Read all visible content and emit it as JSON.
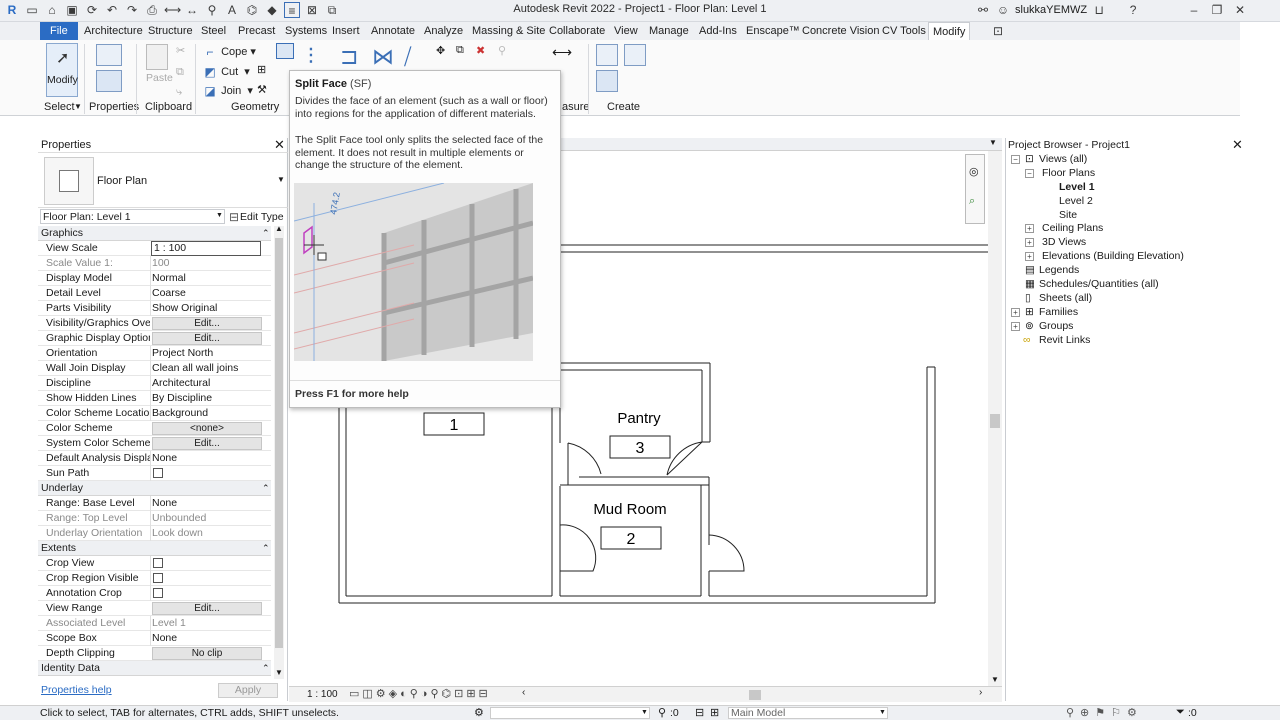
{
  "window": {
    "title": "Autodesk Revit 2022 - Project1 - Floor Plan: Level 1",
    "user": "slukkaYEMWZ"
  },
  "tabs": [
    "File",
    "Architecture",
    "Structure",
    "Steel",
    "Precast",
    "Systems",
    "Insert",
    "Annotate",
    "Analyze",
    "Massing & Site",
    "Collaborate",
    "View",
    "Manage",
    "Add-Ins",
    "Enscape™",
    "Concrete Vision",
    "CV Tools",
    "Modify"
  ],
  "ribbon": {
    "modify_label": "Modify",
    "cope": "Cope",
    "cut": "Cut",
    "join": "Join",
    "paste": "Paste",
    "panels": {
      "select": "Select",
      "properties": "Properties",
      "clipboard": "Clipboard",
      "geometry": "Geometry",
      "measure": "asure",
      "create": "Create"
    }
  },
  "tooltip": {
    "title": "Split Face",
    "shortcut": "(SF)",
    "desc1": "Divides the face of an element (such as a wall or floor) into regions for the application of different materials.",
    "desc2": "The Split Face tool only splits the selected face of the element. It does not result in multiple elements or change the structure of the element.",
    "dimension": "474.2",
    "footer": "Press F1 for more help"
  },
  "properties": {
    "title": "Properties",
    "type_name": "Floor Plan",
    "instance": "Floor Plan: Level 1",
    "edit_type": "Edit Type",
    "groups": {
      "graphics": "Graphics",
      "underlay": "Underlay",
      "extents": "Extents",
      "identity": "Identity Data"
    },
    "rows": {
      "view_scale": {
        "name": "View Scale",
        "value": "1 : 100"
      },
      "scale_value": {
        "name": "Scale Value    1:",
        "value": "100"
      },
      "display_model": {
        "name": "Display Model",
        "value": "Normal"
      },
      "detail_level": {
        "name": "Detail Level",
        "value": "Coarse"
      },
      "parts_visibility": {
        "name": "Parts Visibility",
        "value": "Show Original"
      },
      "vis_graphics": {
        "name": "Visibility/Graphics Over...",
        "value": "Edit..."
      },
      "graphic_display": {
        "name": "Graphic Display Options",
        "value": "Edit..."
      },
      "orientation": {
        "name": "Orientation",
        "value": "Project North"
      },
      "wall_join": {
        "name": "Wall Join Display",
        "value": "Clean all wall joins"
      },
      "discipline": {
        "name": "Discipline",
        "value": "Architectural"
      },
      "hidden_lines": {
        "name": "Show Hidden Lines",
        "value": "By Discipline"
      },
      "color_scheme_loc": {
        "name": "Color Scheme Location",
        "value": "Background"
      },
      "color_scheme": {
        "name": "Color Scheme",
        "value": "<none>"
      },
      "system_color": {
        "name": "System Color Schemes",
        "value": "Edit..."
      },
      "default_analysis": {
        "name": "Default Analysis Displa...",
        "value": "None"
      },
      "sun_path": {
        "name": "Sun Path",
        "value": ""
      },
      "range_base": {
        "name": "Range: Base Level",
        "value": "None"
      },
      "range_top": {
        "name": "Range: Top Level",
        "value": "Unbounded"
      },
      "underlay_orient": {
        "name": "Underlay Orientation",
        "value": "Look down"
      },
      "crop_view": {
        "name": "Crop View",
        "value": ""
      },
      "crop_region": {
        "name": "Crop Region Visible",
        "value": ""
      },
      "annotation_crop": {
        "name": "Annotation Crop",
        "value": ""
      },
      "view_range": {
        "name": "View Range",
        "value": "Edit..."
      },
      "assoc_level": {
        "name": "Associated Level",
        "value": "Level 1"
      },
      "scope_box": {
        "name": "Scope Box",
        "value": "None"
      },
      "depth_clipping": {
        "name": "Depth Clipping",
        "value": "No clip"
      }
    },
    "help": "Properties help",
    "apply": "Apply"
  },
  "floorplan": {
    "rooms": [
      {
        "name": "",
        "number": "1"
      },
      {
        "name": "Pantry",
        "number": "3"
      },
      {
        "name": "Mud Room",
        "number": "2"
      }
    ]
  },
  "viewbar": {
    "scale": "1 : 100"
  },
  "browser": {
    "title": "Project Browser - Project1",
    "views_all": "Views (all)",
    "floor_plans": "Floor Plans",
    "level1": "Level 1",
    "level2": "Level 2",
    "site": "Site",
    "ceiling_plans": "Ceiling Plans",
    "views_3d": "3D Views",
    "elevations": "Elevations (Building Elevation)",
    "legends": "Legends",
    "schedules": "Schedules/Quantities (all)",
    "sheets": "Sheets (all)",
    "families": "Families",
    "groups": "Groups",
    "revit_links": "Revit Links"
  },
  "status": {
    "message": "Click to select, TAB for alternates, CTRL adds, SHIFT unselects.",
    "zero1": ":0",
    "model": "Main Model",
    "zero2": ":0"
  }
}
